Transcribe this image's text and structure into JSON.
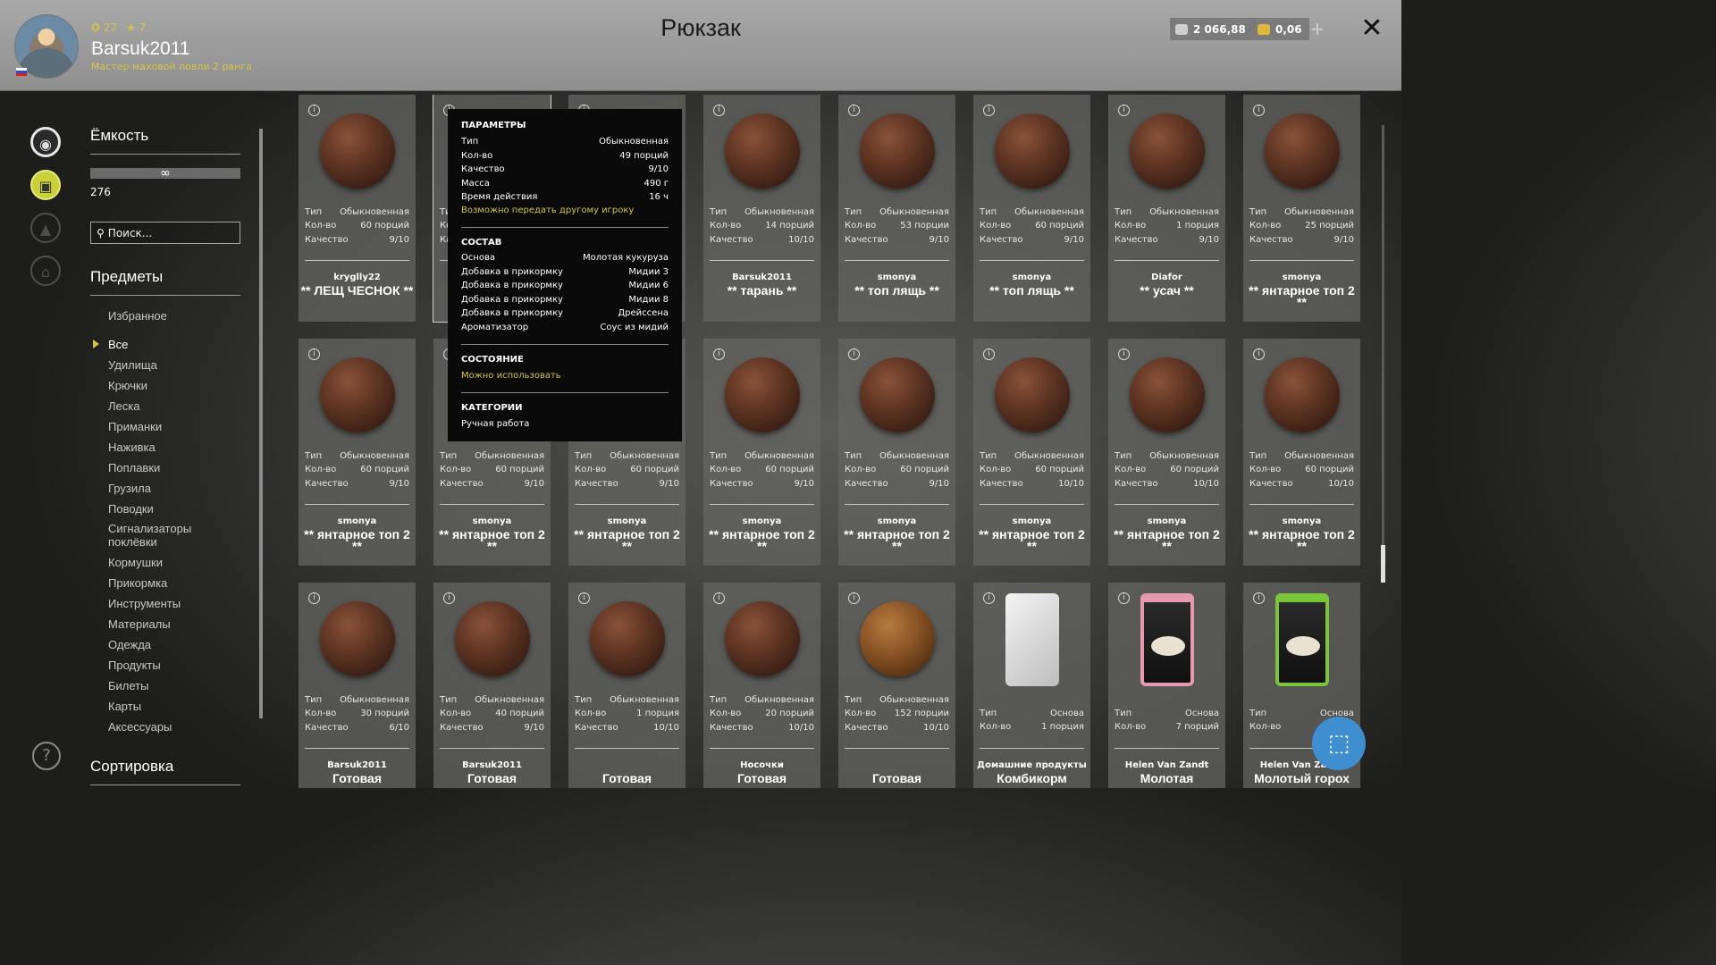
{
  "player": {
    "level": "27",
    "stars": "7",
    "username": "Barsuk2011",
    "rank": "Мастер маховой ловли 2 ранга"
  },
  "title": "Рюкзак",
  "currency": {
    "silver": "2 066,88",
    "gold": "0,06",
    "plus": "+",
    "close": "✕"
  },
  "capacity": {
    "title": "Ёмкость",
    "value": "∞",
    "count": "276"
  },
  "search": {
    "placeholder": "Поиск..."
  },
  "items_title": "Предметы",
  "nav": [
    "Избранное",
    "Все",
    "Удилища",
    "Крючки",
    "Леска",
    "Приманки",
    "Наживка",
    "Поплавки",
    "Грузила",
    "Поводки",
    "Сигнализаторы поклёвки",
    "Кормушки",
    "Прикормка",
    "Инструменты",
    "Материалы",
    "Одежда",
    "Продукты",
    "Билеты",
    "Карты",
    "Аксессуары"
  ],
  "sort_title": "Сортировка",
  "labels": {
    "type": "Тип",
    "qty": "Кол-во",
    "quality": "Качество"
  },
  "cards": [
    {
      "type": "Обыкновенная",
      "qty": "60 порций",
      "quality": "9/10",
      "author": "kryglly22",
      "name": "** ЛЕЩ ЧЕСНОК **",
      "img": "ball"
    },
    {
      "type": "Обыкновенная",
      "qty": "49 порций",
      "quality": "9/10",
      "author": "",
      "name": "",
      "img": "ball"
    },
    {
      "type": "",
      "qty": "",
      "quality": "",
      "author": "",
      "name": "",
      "img": "ball"
    },
    {
      "type": "Обыкновенная",
      "qty": "14 порций",
      "quality": "10/10",
      "author": "Barsuk2011",
      "name": "** тарань **",
      "img": "ball"
    },
    {
      "type": "Обыкновенная",
      "qty": "53 порции",
      "quality": "9/10",
      "author": "smonya",
      "name": "** топ лящь **",
      "img": "ball"
    },
    {
      "type": "Обыкновенная",
      "qty": "60 порций",
      "quality": "9/10",
      "author": "smonya",
      "name": "** топ лящь **",
      "img": "ball"
    },
    {
      "type": "Обыкновенная",
      "qty": "1 порция",
      "quality": "9/10",
      "author": "Diafor",
      "name": "** усач **",
      "img": "ball"
    },
    {
      "type": "Обыкновенная",
      "qty": "25 порций",
      "quality": "9/10",
      "author": "smonya",
      "name": "** янтарное топ 2 **",
      "img": "ball"
    },
    {
      "type": "Обыкновенная",
      "qty": "60 порций",
      "quality": "9/10",
      "author": "smonya",
      "name": "** янтарное топ 2 **",
      "img": "ball"
    },
    {
      "type": "Обыкновенная",
      "qty": "60 порций",
      "quality": "9/10",
      "author": "smonya",
      "name": "** янтарное топ 2 **",
      "img": "ball"
    },
    {
      "type": "Обыкновенная",
      "qty": "60 порций",
      "quality": "9/10",
      "author": "smonya",
      "name": "** янтарное топ 2 **",
      "img": "ball"
    },
    {
      "type": "Обыкновенная",
      "qty": "60 порций",
      "quality": "9/10",
      "author": "smonya",
      "name": "** янтарное топ 2 **",
      "img": "ball"
    },
    {
      "type": "Обыкновенная",
      "qty": "60 порций",
      "quality": "9/10",
      "author": "smonya",
      "name": "** янтарное топ 2 **",
      "img": "ball"
    },
    {
      "type": "Обыкновенная",
      "qty": "60 порций",
      "quality": "10/10",
      "author": "smonya",
      "name": "** янтарное топ 2 **",
      "img": "ball"
    },
    {
      "type": "Обыкновенная",
      "qty": "60 порций",
      "quality": "10/10",
      "author": "smonya",
      "name": "** янтарное топ 2 **",
      "img": "ball"
    },
    {
      "type": "Обыкновенная",
      "qty": "60 порций",
      "quality": "10/10",
      "author": "smonya",
      "name": "** янтарное топ 2 **",
      "img": "ball"
    },
    {
      "type": "Обыкновенная",
      "qty": "30 порций",
      "quality": "6/10",
      "author": "Barsuk2011",
      "name": "Готовая",
      "img": "ball"
    },
    {
      "type": "Обыкновенная",
      "qty": "40 порций",
      "quality": "9/10",
      "author": "Barsuk2011",
      "name": "Готовая",
      "img": "ball"
    },
    {
      "type": "Обыкновенная",
      "qty": "1 порция",
      "quality": "10/10",
      "author": "",
      "name": "Готовая",
      "img": "ball"
    },
    {
      "type": "Обыкновенная",
      "qty": "20 порций",
      "quality": "10/10",
      "author": "Носочки",
      "name": "Готовая",
      "img": "ball"
    },
    {
      "type": "Обыкновенная",
      "qty": "152 порции",
      "quality": "10/10",
      "author": "",
      "name": "Готовая",
      "img": "gold"
    },
    {
      "type": "Основа",
      "qty": "1 порция",
      "quality": "",
      "author": "Домашние продукты",
      "name": "Комбикорм",
      "img": "white"
    },
    {
      "type": "Основа",
      "qty": "7 порций",
      "quality": "",
      "author": "Helen Van Zandt",
      "name": "Молотая",
      "img": "pink"
    },
    {
      "type": "Основа",
      "qty": "",
      "quality": "",
      "author": "Helen Van Zandt",
      "name": "Молотый горох",
      "img": "green"
    }
  ],
  "tooltip": {
    "params_title": "ПАРАМЕТРЫ",
    "params": [
      [
        "Тип",
        "Обыкновенная"
      ],
      [
        "Кол-во",
        "49 порций"
      ],
      [
        "Качество",
        "9/10"
      ],
      [
        "Масса",
        "490 г"
      ],
      [
        "Время действия",
        "16 ч"
      ]
    ],
    "transfer": "Возможно передать другому игроку",
    "comp_title": "СОСТАВ",
    "comp": [
      [
        "Основа",
        "Молотая кукуруза"
      ],
      [
        "Добавка в прикормку",
        "Мидии 3"
      ],
      [
        "Добавка в прикормку",
        "Мидии 6"
      ],
      [
        "Добавка в прикормку",
        "Мидии 8"
      ],
      [
        "Добавка в прикормку",
        "Дрейссена"
      ],
      [
        "Ароматизатор",
        "Соус из мидий"
      ]
    ],
    "state_title": "СОСТОЯНИЕ",
    "state": "Можно использовать",
    "cat_title": "КАТЕГОРИИ",
    "cat": "Ручная работа"
  },
  "colors": {
    "accent_yellow": "#d2c44a",
    "fab_blue": "#3f8ed0"
  }
}
